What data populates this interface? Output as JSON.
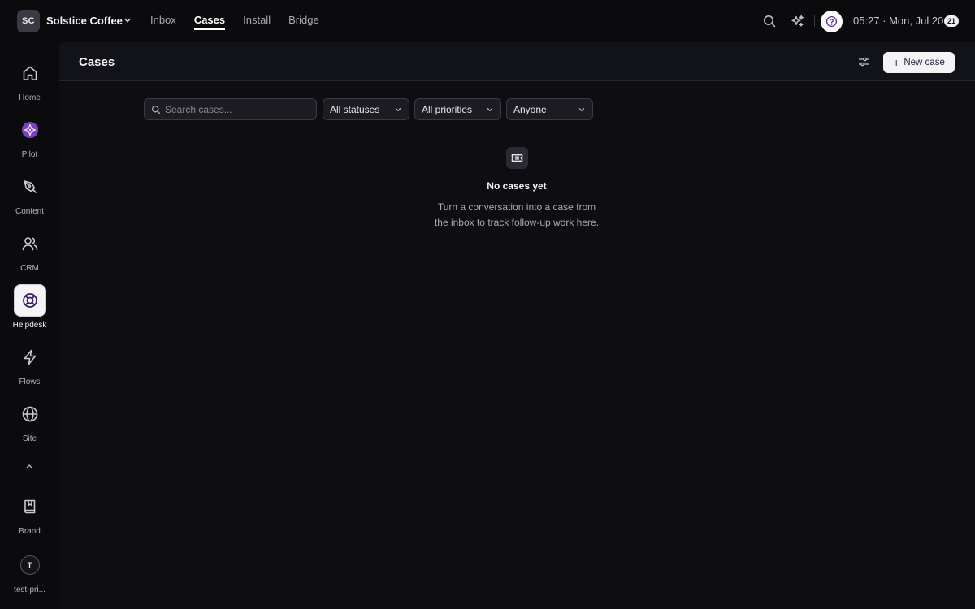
{
  "workspace": {
    "initials": "SC",
    "name": "Solstice Coffee"
  },
  "topnav": [
    {
      "label": "Inbox",
      "active": false
    },
    {
      "label": "Cases",
      "active": true
    },
    {
      "label": "Install",
      "active": false
    },
    {
      "label": "Bridge",
      "active": false
    }
  ],
  "topbar": {
    "clock": "05:27 · Mon, Jul 20",
    "date_badge": "21"
  },
  "sidebar": {
    "items": [
      {
        "label": "Home",
        "icon": "home-icon"
      },
      {
        "label": "Pilot",
        "icon": "pilot-icon"
      },
      {
        "label": "Content",
        "icon": "pen-icon"
      },
      {
        "label": "CRM",
        "icon": "users-icon"
      },
      {
        "label": "Helpdesk",
        "icon": "lifebuoy-icon",
        "active": true
      },
      {
        "label": "Flows",
        "icon": "bolt-icon"
      },
      {
        "label": "Site",
        "icon": "globe-icon"
      }
    ],
    "bottom": [
      {
        "label": "Brand",
        "icon": "book-icon"
      },
      {
        "label": "test-pri...",
        "initial": "T"
      }
    ]
  },
  "header": {
    "title": "Cases",
    "new_case_label": "New case"
  },
  "filters": {
    "search_placeholder": "Search cases...",
    "status": "All statuses",
    "priority": "All priorities",
    "assignee": "Anyone"
  },
  "empty_state": {
    "title": "No cases yet",
    "line1": "Turn a conversation into a case from",
    "line2": "the inbox to track follow-up work here."
  },
  "colors": {
    "accent": "#8b4fd6",
    "background": "#0b0b0e",
    "panel": "#121219"
  }
}
